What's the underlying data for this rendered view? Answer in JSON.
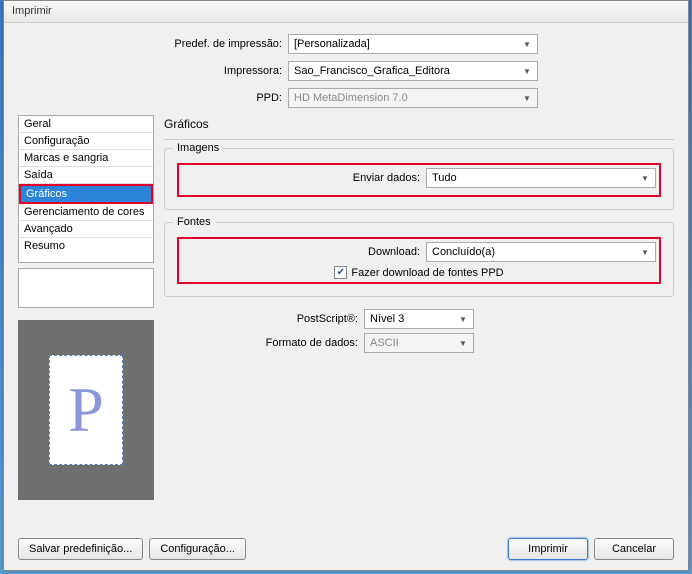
{
  "window": {
    "title": "Imprimir"
  },
  "top": {
    "preset_label": "Predef. de impressão:",
    "preset_value": "[Personalizada]",
    "printer_label": "Impressora:",
    "printer_value": "Sao_Francisco_Grafica_Editora",
    "ppd_label": "PPD:",
    "ppd_value": "HD MetaDimension 7.0"
  },
  "sidebar": {
    "items": [
      "Geral",
      "Configuração",
      "Marcas e sangria",
      "Saída",
      "Gráficos",
      "Gerenciamento de cores",
      "Avançado",
      "Resumo"
    ]
  },
  "main": {
    "heading": "Gráficos",
    "images": {
      "legend": "Imagens",
      "send_label": "Enviar dados:",
      "send_value": "Tudo"
    },
    "fonts": {
      "legend": "Fontes",
      "download_label": "Download:",
      "download_value": "Concluído(a)",
      "checkbox_label": "Fazer download de fontes PPD"
    },
    "postscript_label": "PostScript®:",
    "postscript_value": "Nível 3",
    "dataformat_label": "Formato de dados:",
    "dataformat_value": "ASCII"
  },
  "preview": {
    "glyph": "P"
  },
  "footer": {
    "save_preset": "Salvar predefinição...",
    "config": "Configuração...",
    "print": "Imprimir",
    "cancel": "Cancelar"
  }
}
